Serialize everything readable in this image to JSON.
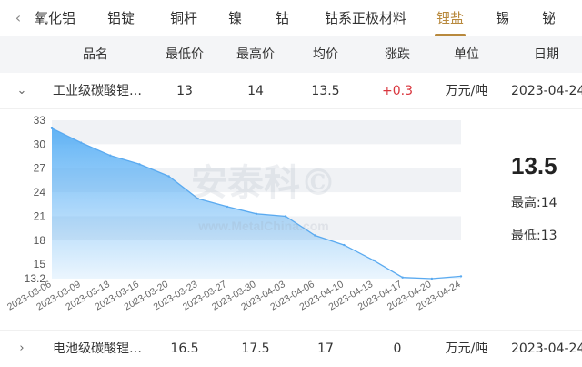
{
  "tabs": {
    "prev_arrow": "‹",
    "items": [
      "氧化铝",
      "铝锭",
      "铜杆",
      "镍",
      "钴",
      "钴系正极材料",
      "锂盐",
      "锡",
      "铋"
    ],
    "active_index": 6
  },
  "table": {
    "headers": [
      "品名",
      "最低价",
      "最高价",
      "均价",
      "涨跌",
      "单位",
      "日期"
    ]
  },
  "rows": [
    {
      "expand_icon": "chevron-down",
      "expand_glyph": "⌄",
      "name": "工业级碳酸锂…",
      "low": "13",
      "high": "14",
      "avg": "13.5",
      "change": "+0.3",
      "unit": "万元/吨",
      "date": "2023-04-24"
    },
    {
      "expand_icon": "chevron-right",
      "expand_glyph": "›",
      "name": "电池级碳酸锂…",
      "low": "16.5",
      "high": "17.5",
      "avg": "17",
      "change": "0",
      "unit": "万元/吨",
      "date": "2023-04-24"
    }
  ],
  "summary": {
    "avg": "13.5",
    "high_label": "最高:14",
    "low_label": "最低:13"
  },
  "chart_data": {
    "type": "area",
    "x": [
      "2023-03-06",
      "2023-03-09",
      "2023-03-13",
      "2023-03-16",
      "2023-03-20",
      "2023-03-23",
      "2023-03-27",
      "2023-03-30",
      "2023-04-03",
      "2023-04-06",
      "2023-04-10",
      "2023-04-13",
      "2023-04-17",
      "2023-04-20",
      "2023-04-24"
    ],
    "values": [
      32,
      30.2,
      28.6,
      27.5,
      26,
      23.2,
      22.2,
      21.3,
      21,
      18.6,
      17.4,
      15.5,
      13.35,
      13.2,
      13.5
    ],
    "yticks": [
      15,
      18,
      21,
      24,
      27,
      30,
      33
    ],
    "ymin_label": "13.2",
    "ylim": [
      13.2,
      33
    ],
    "grid": true,
    "line_color": "#5aaaf0",
    "fill_color": "#5ab0f5",
    "band_color": "#f0f2f5"
  },
  "watermark": {
    "cn": "安泰科©",
    "url": "www.MetalChina.com"
  }
}
